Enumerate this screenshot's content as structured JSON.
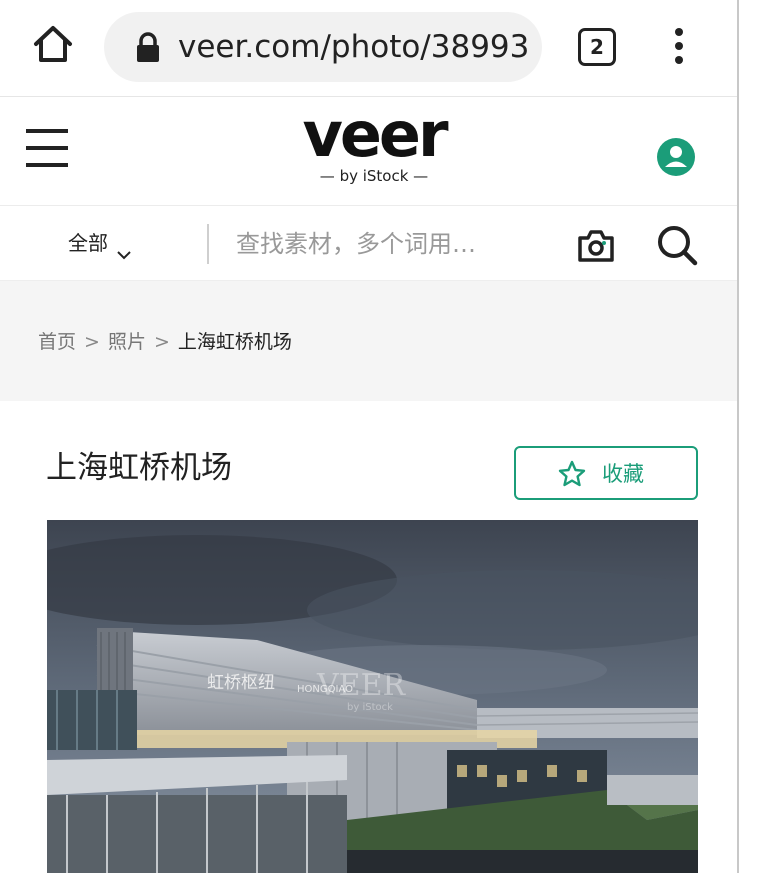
{
  "browser": {
    "url": "veer.com/photo/38993",
    "tab_count": "2"
  },
  "header": {
    "logo_main": "veer",
    "logo_sub": "— by iStock —"
  },
  "search": {
    "category": "全部",
    "placeholder": "查找素材，多个词用…"
  },
  "breadcrumb": {
    "items": [
      "首页",
      "照片"
    ],
    "separator": ">",
    "current": "上海虹桥机场"
  },
  "page": {
    "title": "上海虹桥机场",
    "favorite_label": "收藏"
  },
  "photo": {
    "sign_text": "虹桥枢纽",
    "sign_text_en": "HONGQIAO",
    "watermark": "VEER",
    "watermark_sub": "by iStock"
  },
  "colors": {
    "accent": "#1b9d79",
    "breadcrumb_bg": "#f5f5f5",
    "url_pill_bg": "#f1f1f1"
  },
  "icons": {
    "home": "home-icon",
    "lock": "lock-icon",
    "tabs": "tabs-icon",
    "menu": "more-vert-icon",
    "hamburger": "hamburger-icon",
    "user": "user-icon",
    "chevron": "chevron-down-icon",
    "camera": "camera-icon",
    "search": "search-icon",
    "star": "star-outline-icon"
  }
}
